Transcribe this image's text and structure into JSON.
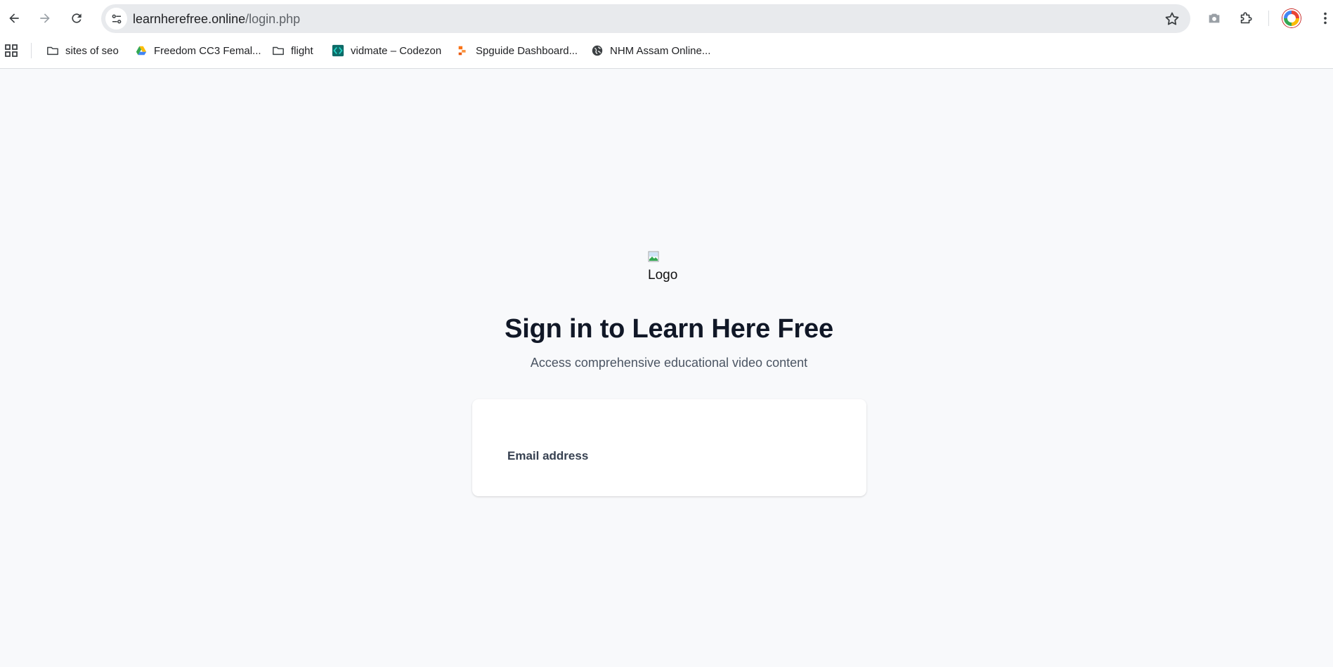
{
  "browser": {
    "url_host": "learnherefree.online",
    "url_path": "/login.php",
    "icons": {
      "back": "arrow-left-icon",
      "forward": "arrow-right-icon",
      "reload": "reload-icon",
      "site_info": "tune-icon",
      "bookmark_star": "star-icon",
      "camera": "camera-icon",
      "extensions": "puzzle-icon",
      "menu": "more-vertical-icon"
    }
  },
  "bookmarks": [
    {
      "label": "sites of seo",
      "icon": "folder-icon"
    },
    {
      "label": "Freedom CC3 Femal...",
      "icon": "google-drive-icon"
    },
    {
      "label": "flight",
      "icon": "folder-icon"
    },
    {
      "label": "vidmate – Codezon",
      "icon": "codezon-icon"
    },
    {
      "label": "Spguide Dashboard...",
      "icon": "spguide-icon"
    },
    {
      "label": "NHM Assam Online...",
      "icon": "globe-icon"
    }
  ],
  "page": {
    "logo_alt": "Logo",
    "title": "Sign in to Learn Here Free",
    "subtitle": "Access comprehensive educational video content",
    "email_label": "Email address"
  },
  "colors": {
    "page_background": "#f8f9fb",
    "title": "#111827",
    "subtitle": "#4b5563",
    "card": "#ffffff"
  }
}
